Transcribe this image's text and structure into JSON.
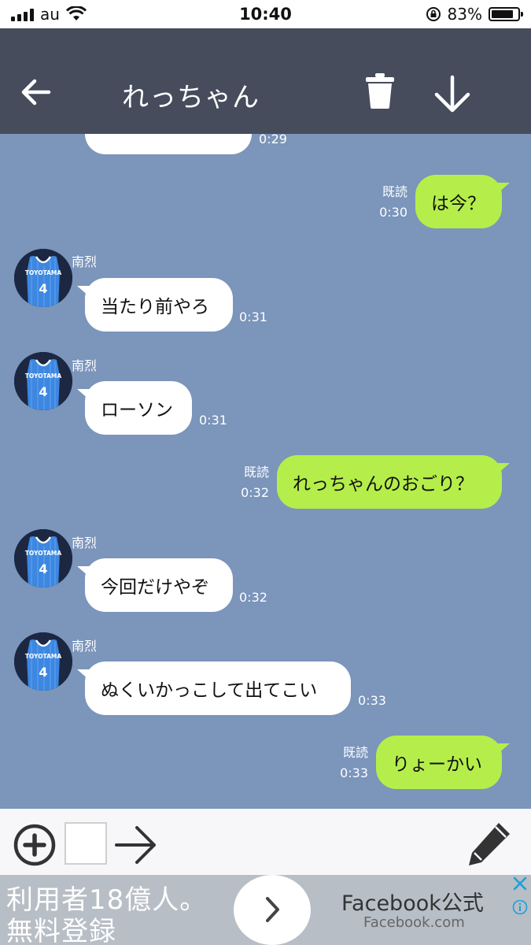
{
  "status_bar": {
    "carrier": "au",
    "time": "10:40",
    "battery": "83%",
    "battery_level": 0.83
  },
  "header": {
    "title": "れっちゃん",
    "back_icon": "arrow-left-icon",
    "trash_icon": "trash-icon",
    "down_icon": "arrow-down-icon"
  },
  "chat": {
    "messages": [
      {
        "side": "in",
        "text": "",
        "time": "0:29"
      },
      {
        "side": "out",
        "text": "は今？",
        "read": "既読",
        "time": "0:30"
      },
      {
        "side": "in",
        "sender": "南烈",
        "text": "当たり前やろ",
        "time": "0:31"
      },
      {
        "side": "in",
        "sender": "南烈",
        "text": "ローソン",
        "time": "0:31"
      },
      {
        "side": "out",
        "text": "れっちゃんのおごり？",
        "read": "既読",
        "time": "0:32"
      },
      {
        "side": "in",
        "sender": "南烈",
        "text": "今回だけやぞ",
        "time": "0:32"
      },
      {
        "side": "in",
        "sender": "南烈",
        "text": "ぬくいかっこして出てこい",
        "time": "0:33"
      },
      {
        "side": "out",
        "text": "りょーかい",
        "read": "既読",
        "time": "0:33"
      }
    ],
    "avatar_text": "TOYOTAMA",
    "avatar_number": "4"
  },
  "input_bar": {
    "plus_icon": "plus-circle-icon",
    "text_value": "",
    "send_icon": "arrow-right-icon",
    "pen_icon": "pencil-icon"
  },
  "ad": {
    "line1": "利用者18億人。",
    "line2": "無料登録",
    "title": "Facebook公式",
    "url": "Facebook.com",
    "chevron_icon": "chevron-right-icon",
    "close_icon": "close-icon",
    "info_icon": "info-icon"
  },
  "colors": {
    "header_bg": "#464c5c",
    "chat_bg": "#7b95bb",
    "outgoing_bubble": "#b5ee4a",
    "incoming_bubble": "#ffffff",
    "input_bar_bg": "#f7f7f9",
    "ad_bg": "#b8bec6"
  }
}
